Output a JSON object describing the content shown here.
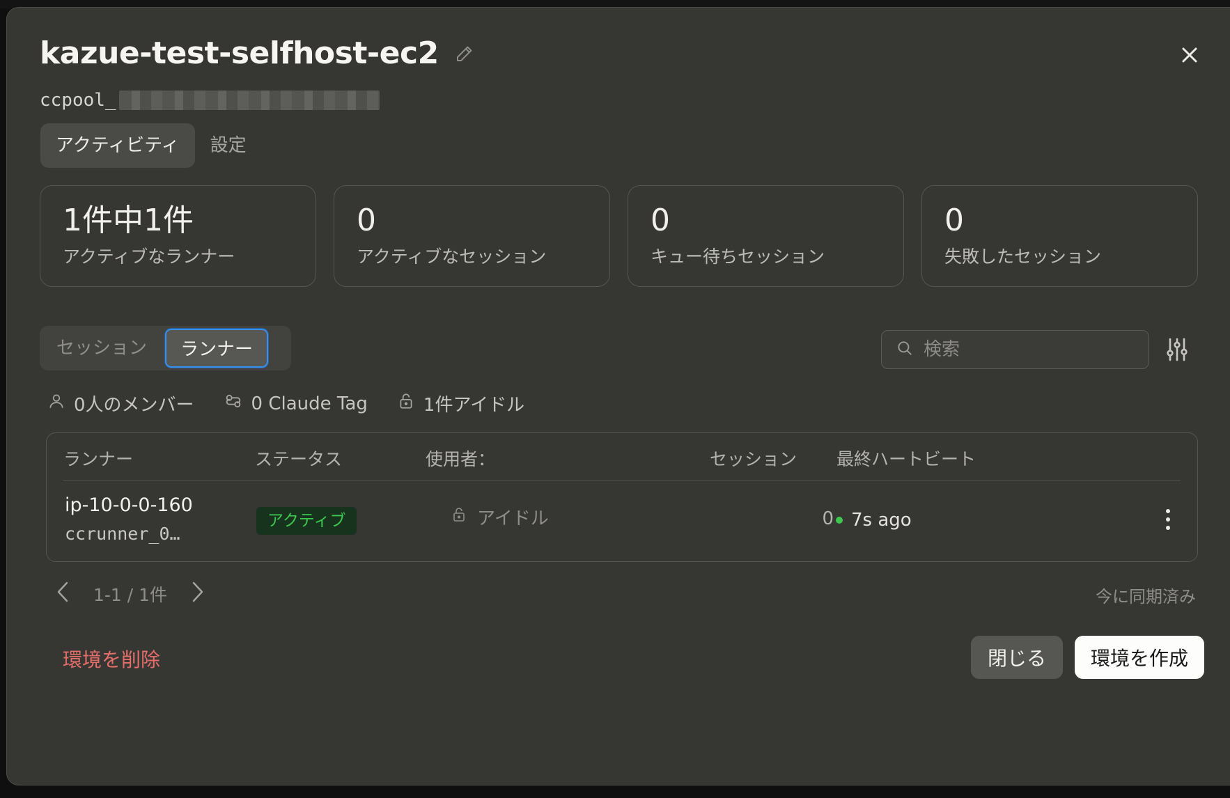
{
  "header": {
    "title": "kazue-test-selfhost-ec2",
    "pool_id_prefix": "ccpool_"
  },
  "top_tabs": [
    {
      "label": "アクティビティ",
      "active": true
    },
    {
      "label": "設定",
      "active": false
    }
  ],
  "stats": [
    {
      "value": "1件中1件",
      "label": "アクティブなランナー"
    },
    {
      "value": "0",
      "label": "アクティブなセッション"
    },
    {
      "value": "0",
      "label": "キュー待ちセッション"
    },
    {
      "value": "0",
      "label": "失敗したセッション"
    }
  ],
  "segment": {
    "sessions_label": "セッション",
    "runners_label": "ランナー",
    "selected": "ランナー"
  },
  "search": {
    "placeholder": "検索",
    "value": ""
  },
  "meta": {
    "members": "0人のメンバー",
    "claude_tag": "0 Claude Tag",
    "idle": "1件アイドル"
  },
  "table": {
    "headers": [
      "ランナー",
      "ステータス",
      "使用者：",
      "セッション",
      "最終ハートビート"
    ],
    "rows": [
      {
        "runner_name": "ip-10-0-0-160",
        "runner_id": "ccrunner_0…",
        "status": "アクティブ",
        "user": "アイドル",
        "sessions": "0",
        "heartbeat": "7s ago"
      }
    ]
  },
  "pagination": {
    "range": "1-1 / 1件"
  },
  "sync_status": "今に同期済み",
  "footer": {
    "delete_label": "環境を削除",
    "close_label": "閉じる",
    "create_label": "環境を作成"
  },
  "colors": {
    "background": "#363633",
    "accent_blue": "#3d8ee8",
    "status_green": "#3ec64e",
    "danger_red": "#e46e69"
  },
  "icons": [
    "pencil-icon",
    "close-icon",
    "search-icon",
    "sliders-icon",
    "user-icon",
    "tag-icon",
    "lock-icon",
    "kebab-icon",
    "chevron-left-icon",
    "chevron-right-icon"
  ]
}
